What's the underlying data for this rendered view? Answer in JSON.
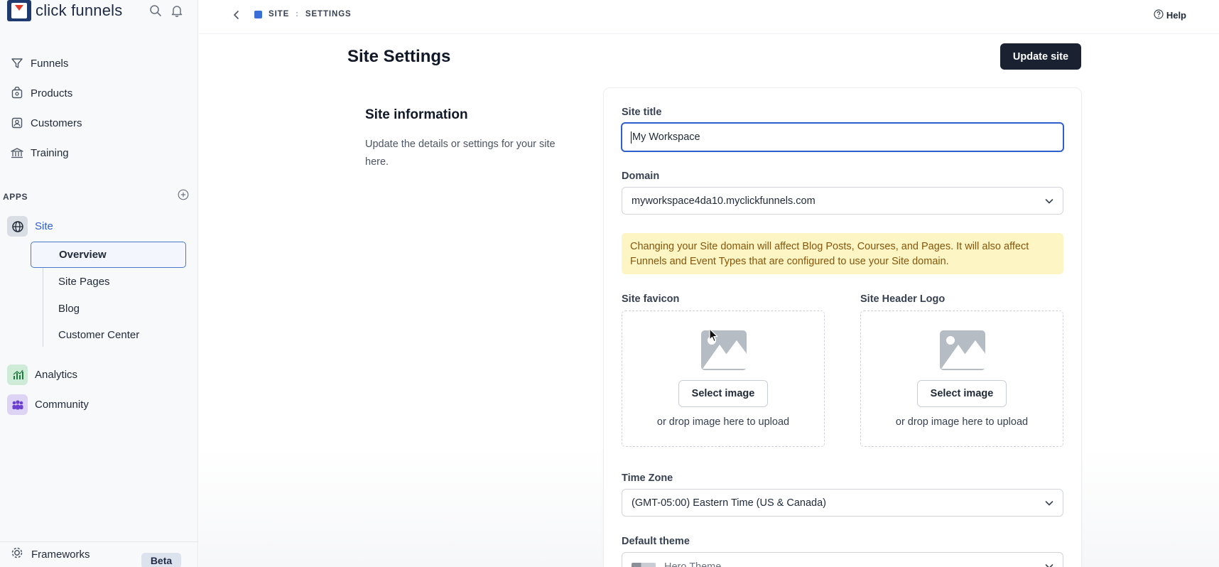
{
  "brand": {
    "name": "click funnels"
  },
  "nav": {
    "items": [
      {
        "label": "Funnels",
        "icon": "funnel-icon"
      },
      {
        "label": "Products",
        "icon": "products-icon"
      },
      {
        "label": "Customers",
        "icon": "customers-icon"
      },
      {
        "label": "Training",
        "icon": "training-icon"
      }
    ]
  },
  "apps": {
    "header": "APPS",
    "site": {
      "label": "Site"
    },
    "site_sub": [
      "Overview",
      "Site Pages",
      "Blog",
      "Customer Center"
    ],
    "analytics": {
      "label": "Analytics"
    },
    "community": {
      "label": "Community"
    }
  },
  "frameworks": {
    "label": "Frameworks",
    "badge": "Beta"
  },
  "breadcrumb": {
    "site": "SITE",
    "separator": ":",
    "settings": "SETTINGS"
  },
  "help": {
    "label": "Help"
  },
  "page": {
    "title": "Site Settings",
    "update_button": "Update site"
  },
  "section": {
    "title": "Site information",
    "description": "Update the details or settings for your site here."
  },
  "form": {
    "site_title": {
      "label": "Site title",
      "value": "My Workspace"
    },
    "domain": {
      "label": "Domain",
      "value": "myworkspace4da10.myclickfunnels.com"
    },
    "warning": "Changing your Site domain will affect Blog Posts, Courses, and Pages. It will also affect Funnels and Event Types that are configured to use your Site domain.",
    "favicon": {
      "label": "Site favicon",
      "button": "Select image",
      "hint": "or drop image here to upload"
    },
    "header_logo": {
      "label": "Site Header Logo",
      "button": "Select image",
      "hint": "or drop image here to upload"
    },
    "time_zone": {
      "label": "Time Zone",
      "value": "(GMT-05:00) Eastern Time (US & Canada)"
    },
    "default_theme": {
      "label": "Default theme",
      "value": "Hero Theme"
    }
  },
  "colors": {
    "accent": "#2f5fcf",
    "primary_button": "#1a2232",
    "warning_bg": "#fdf5c4",
    "warning_text": "#85560b"
  }
}
